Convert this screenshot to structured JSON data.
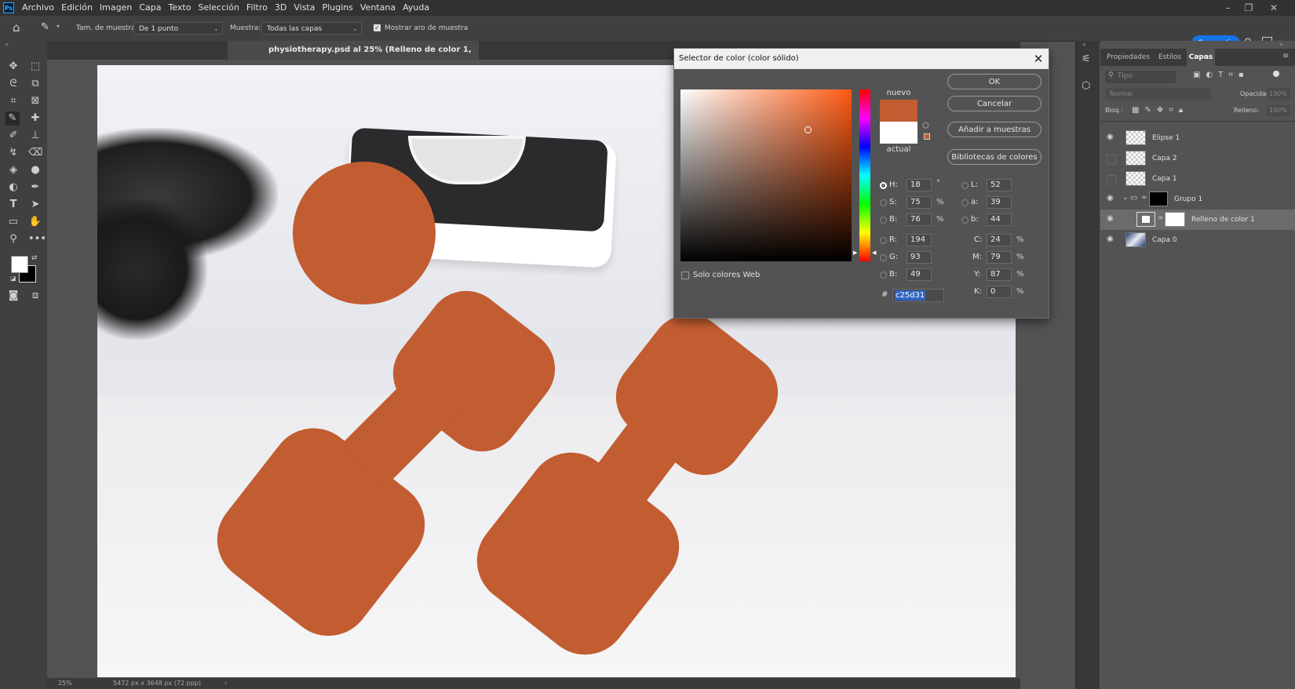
{
  "app": {
    "logo": "Ps"
  },
  "menu": [
    "Archivo",
    "Edición",
    "Imagen",
    "Capa",
    "Texto",
    "Selección",
    "Filtro",
    "3D",
    "Vista",
    "Plugins",
    "Ventana",
    "Ayuda"
  ],
  "options": {
    "sample_size_label": "Tam. de muestra:",
    "sample_size_value": "De 1 punto",
    "sample_label": "Muestra:",
    "sample_value": "Todas las capas",
    "show_ring_label": "Mostrar aro de muestra",
    "show_ring_checked": true,
    "share_label": "Compartir"
  },
  "document": {
    "tab_title": "physiotherapy.psd al 25% (Relleno de color 1, RGB/",
    "zoom": "25%",
    "dimensions": "5472 px x 3648 px (72 ppp)",
    "fill_color": "#c25d31"
  },
  "panel": {
    "tabs": [
      "Propiedades",
      "Estilos",
      "Capas"
    ],
    "active_tab": "Capas",
    "search_placeholder": "Tipo",
    "blend_mode": "Normal",
    "opacity_label": "Opacidad:",
    "opacity_value": "100%",
    "lock_label": "Bloq.:",
    "fill_label": "Relleno:",
    "fill_value": "100%",
    "layers": [
      {
        "name": "Elipse 1",
        "visible": true
      },
      {
        "name": "Capa 2",
        "visible": false
      },
      {
        "name": "Capa 1",
        "visible": false
      },
      {
        "name": "Grupo 1",
        "visible": true
      },
      {
        "name": "Relleno de color 1",
        "visible": true,
        "selected": true
      },
      {
        "name": "Capa 0",
        "visible": true
      }
    ]
  },
  "dialog": {
    "title": "Selector de color (color sólido)",
    "ok": "OK",
    "cancel": "Cancelar",
    "add_swatches": "Añadir a muestras",
    "color_libraries": "Bibliotecas de colores",
    "new_label": "nuevo",
    "current_label": "actual",
    "new_color": "#c25d31",
    "current_color": "#ffffff",
    "web_only_label": "Solo colores Web",
    "hsb": {
      "H": "18",
      "S": "75",
      "B": "76"
    },
    "h_unit": "°",
    "pct": "%",
    "rgb": {
      "R": "194",
      "G": "93",
      "B": "49"
    },
    "lab": {
      "L": "52",
      "a": "39",
      "b": "44"
    },
    "cmyk": {
      "C": "24",
      "M": "79",
      "Y": "87",
      "K": "0"
    },
    "hex_label": "#",
    "hex": "c25d31"
  }
}
